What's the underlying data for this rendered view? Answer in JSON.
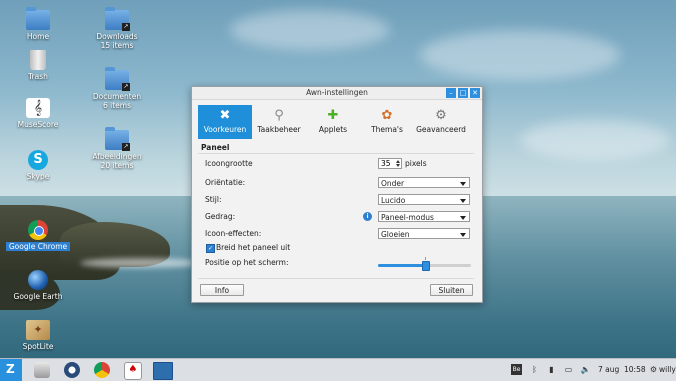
{
  "desktop": {
    "icons": [
      {
        "label": "Home",
        "icon": "home-folder-icon"
      },
      {
        "label": "Downloads",
        "sub": "15 items",
        "icon": "downloads-folder-icon"
      },
      {
        "label": "Trash",
        "icon": "trash-icon"
      },
      {
        "label": "Documenten",
        "sub": "6 items",
        "icon": "documents-folder-icon"
      },
      {
        "label": "MuseScore",
        "icon": "musescore-icon"
      },
      {
        "label": "Afbeeldingen",
        "sub": "20 items",
        "icon": "pictures-folder-icon"
      },
      {
        "label": "Skype",
        "icon": "skype-icon"
      },
      {
        "label": "Google Chrome",
        "icon": "chrome-icon"
      },
      {
        "label": "Google Earth",
        "icon": "google-earth-icon"
      },
      {
        "label": "SpotLite",
        "icon": "spotlite-icon"
      }
    ]
  },
  "dialog": {
    "title": "Awn-instellingen",
    "tabs": [
      {
        "label": "Voorkeuren",
        "icon": "preferences-tools-icon",
        "active": true
      },
      {
        "label": "Taakbeheer",
        "icon": "task-manager-icon",
        "active": false
      },
      {
        "label": "Applets",
        "icon": "applets-puzzle-icon",
        "active": false
      },
      {
        "label": "Thema's",
        "icon": "themes-palette-icon",
        "active": false
      },
      {
        "label": "Geavanceerd",
        "icon": "advanced-gear-icon",
        "active": false
      }
    ],
    "section": "Paneel",
    "icon_size": {
      "label": "Icoongrootte",
      "value": "35",
      "unit": "pixels"
    },
    "orientation": {
      "label": "Oriëntatie:",
      "value": "Onder"
    },
    "style": {
      "label": "Stijl:",
      "value": "Lucido"
    },
    "behavior": {
      "label": "Gedrag:",
      "value": "Paneel-modus"
    },
    "icon_effects": {
      "label": "Icoon-effecten:",
      "value": "Gloeien"
    },
    "expand": {
      "label": "Breid het paneel uit",
      "checked": true
    },
    "position": {
      "label": "Positie op het scherm:",
      "value": 0.5
    },
    "buttons": {
      "info": "Info",
      "close": "Sluiten"
    }
  },
  "panel": {
    "keyboard_layout": "Be",
    "date": "7 aug",
    "time": "10:58",
    "user": "willy"
  },
  "colors": {
    "accent": "#1e8fd8",
    "panel": "#dcdfe3"
  }
}
